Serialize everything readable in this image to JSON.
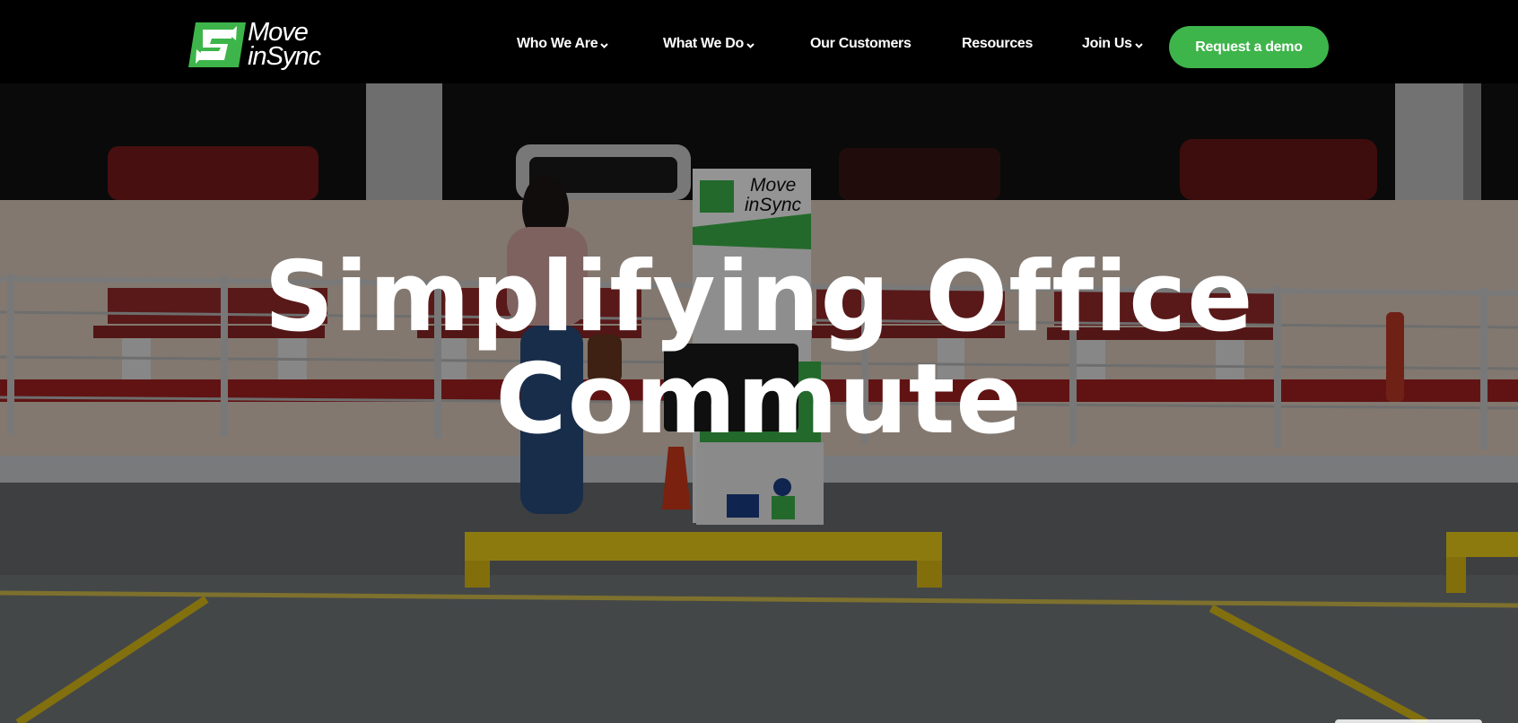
{
  "brand": {
    "name_line1": "Move",
    "name_line2": "inSync",
    "accent": "#3db54a",
    "logo_icon": "swap-arrows-s-icon"
  },
  "nav": {
    "items": [
      {
        "label": "Who We Are",
        "has_dropdown": true
      },
      {
        "label": "What We Do",
        "has_dropdown": true
      },
      {
        "label": "Our Customers",
        "has_dropdown": false
      },
      {
        "label": "Resources",
        "has_dropdown": false
      },
      {
        "label": "Join Us",
        "has_dropdown": true
      }
    ],
    "cta_label": "Request a demo"
  },
  "hero": {
    "headline_line1": "Simplifying Office",
    "headline_line2": "Commute",
    "kiosk_brand_line1": "Move",
    "kiosk_brand_line2": "inSync"
  }
}
